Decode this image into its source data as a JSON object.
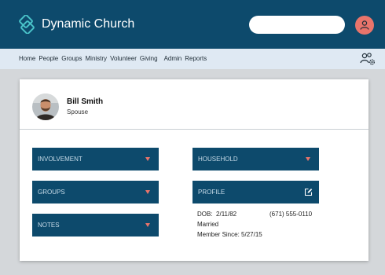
{
  "app": {
    "title": "Dynamic Church"
  },
  "search": {
    "placeholder": "",
    "value": ""
  },
  "nav": {
    "items": [
      "Home",
      "People",
      "Groups",
      "Ministry",
      "Volunteer",
      "Giving",
      "Admin",
      "Reports"
    ]
  },
  "person": {
    "name": "Bill Smith",
    "role": "Spouse"
  },
  "panels": {
    "involvement": "INVOLVEMENT",
    "groups": "GROUPS",
    "notes": "NOTES",
    "household": "HOUSEHOLD",
    "profile": "PROFILE"
  },
  "profile_details": {
    "dob_label": "DOB:",
    "dob": "2/11/82",
    "phone": "(671) 555-0110",
    "marital_status": "Married",
    "member_since_label": "Member Since:",
    "member_since": "5/27/15"
  },
  "colors": {
    "header_bg": "#0d4a6c",
    "nav_bg": "#dfe9f3",
    "accent": "#e8746b",
    "logo": "#49c2c9",
    "panel_bg": "#0d4a6c"
  },
  "icons": {
    "logo": "interlocking-diamond-logo",
    "avatar": "user-icon",
    "admin": "users-gear-icon",
    "caret": "caret-down-icon",
    "edit": "edit-icon"
  }
}
